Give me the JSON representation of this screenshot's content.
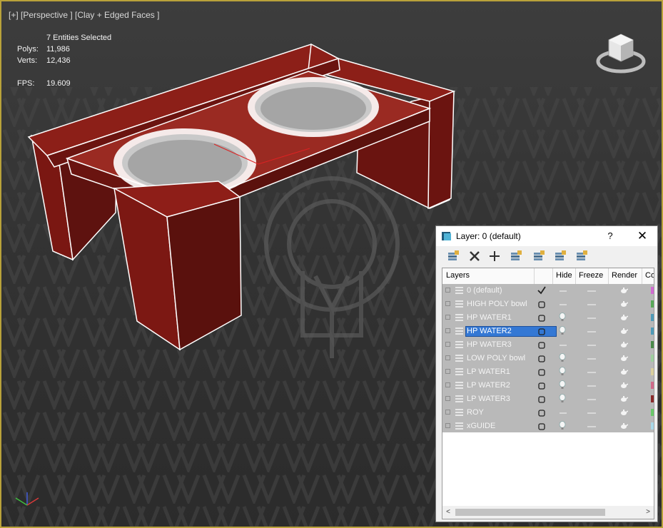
{
  "viewport": {
    "label": "[+] [Perspective ] [Clay + Edged Faces ]",
    "selection": "7 Entities Selected",
    "polys_label": "Polys:",
    "polys_value": "11,986",
    "verts_label": "Verts:",
    "verts_value": "12,436",
    "fps_label": "FPS:",
    "fps_value": "19.609"
  },
  "colors": {
    "viewport_border": "#b9a23a",
    "model_red": "#7a1712",
    "stats_text": "#e8d76a",
    "selection_blue": "#3478d4"
  },
  "layer_dialog": {
    "title": "Layer: 0 (default)",
    "help_label": "?",
    "close_label": "✕",
    "toolbar": [
      "new-layer-icon",
      "delete-layer-icon",
      "add-to-layer-icon",
      "select-in-layer-icon",
      "highlight-layer-icon",
      "hide-all-icon",
      "freeze-all-icon"
    ],
    "columns": {
      "layers": "Layers",
      "hide": "Hide",
      "freeze": "Freeze",
      "render": "Render",
      "color": "Co"
    },
    "layers": [
      {
        "name": "0 (default)",
        "current": true,
        "hidden": false,
        "color": "#d16bd1"
      },
      {
        "name": "HIGH POLY bowl",
        "current": false,
        "hidden": false,
        "color": "#58a858"
      },
      {
        "name": "HP WATER1",
        "current": false,
        "hidden": true,
        "color": "#4f9bb8"
      },
      {
        "name": "HP WATER2",
        "current": false,
        "hidden": true,
        "color": "#4f9bb8",
        "selected": true
      },
      {
        "name": "HP WATER3",
        "current": false,
        "hidden": false,
        "color": "#4a8a4a"
      },
      {
        "name": "LOW POLY bowl",
        "current": false,
        "hidden": true,
        "color": "#9ecf9e"
      },
      {
        "name": "LP WATER1",
        "current": false,
        "hidden": true,
        "color": "#d9cf9e"
      },
      {
        "name": "LP WATER2",
        "current": false,
        "hidden": true,
        "color": "#d06a8a"
      },
      {
        "name": "LP WATER3",
        "current": false,
        "hidden": true,
        "color": "#8a2a2a"
      },
      {
        "name": "ROY",
        "current": false,
        "hidden": false,
        "color": "#6ac86a"
      },
      {
        "name": "xGUIDE",
        "current": false,
        "hidden": true,
        "color": "#a8d8e8"
      }
    ]
  }
}
